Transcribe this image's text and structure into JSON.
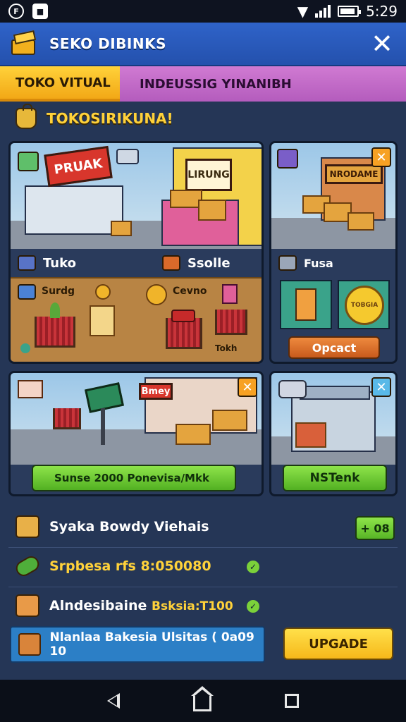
{
  "status_bar": {
    "time": "5:29",
    "left_icon_1": "F",
    "left_icon_2": "■"
  },
  "header": {
    "title": "SEKO DIBINKS",
    "close_glyph": "✕"
  },
  "tabs": [
    {
      "label": "TOKO VITUAL",
      "active": true
    },
    {
      "label": "INDEUSSIG YINANIBH",
      "active": false
    }
  ],
  "section": {
    "title": "TOKOSIRIKUNA!"
  },
  "cards": {
    "store": {
      "sign": "PRUAK",
      "awning_sign": "LIRUNG",
      "left_label": "Tuko",
      "right_label": "Ssolle",
      "item_left": "Surdg",
      "item_right": "Cevno",
      "item_bottom": "Tokh"
    },
    "market": {
      "sign": "NRODAME",
      "label": "Fusa",
      "button": "Opcact",
      "coin_text": "TOBGIA"
    },
    "delivery": {
      "sign": "Bmey",
      "button": "Sunse 2000 Ponevisa/Mkk"
    },
    "warehouse": {
      "button": "NSTenk"
    }
  },
  "list": {
    "rows": [
      {
        "text": "Syaka Bowdy Viehais"
      },
      {
        "text": "Srpbesa rfs 8:050080"
      },
      {
        "text": "Alndesibaine",
        "highlight": "Bsksia:T100"
      },
      {
        "text": "Nlanlaa Bakesia Ulsitas ( 0a09 10"
      }
    ],
    "badge": "+ 08",
    "upgrade_button": "UPGADE"
  },
  "colors": {
    "header_blue": "#2f63c9",
    "tab_yellow": "#ffd23a",
    "tab_purple": "#c46bc9",
    "button_green": "#7bd13a",
    "button_orange": "#e07a32",
    "button_yellow": "#ffd23a"
  },
  "icons": [
    "settings-icon",
    "notification-icon",
    "wifi-icon",
    "signal-icon",
    "battery-icon",
    "close-icon",
    "bag-icon",
    "back-icon",
    "home-icon",
    "recent-apps-icon"
  ]
}
